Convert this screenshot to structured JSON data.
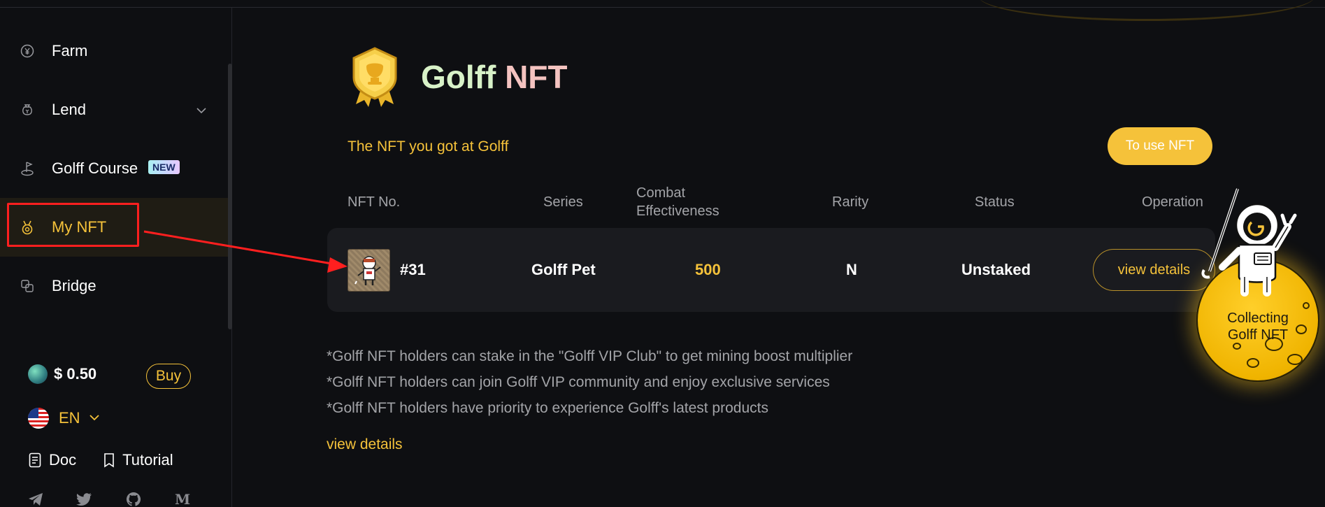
{
  "sidebar": {
    "items": [
      {
        "label": "Farm",
        "icon": "yen-coin-icon"
      },
      {
        "label": "Lend",
        "icon": "money-bag-icon"
      },
      {
        "label": "Golff Course",
        "icon": "golf-flag-icon",
        "badge": "NEW"
      },
      {
        "label": "My NFT",
        "icon": "medal-icon",
        "active": true
      },
      {
        "label": "Bridge",
        "icon": "bridge-icon"
      }
    ],
    "price": "$ 0.50",
    "buy_label": "Buy",
    "language": "EN",
    "links": [
      {
        "label": "Doc",
        "icon": "document-icon"
      },
      {
        "label": "Tutorial",
        "icon": "bookmark-icon"
      }
    ],
    "social": [
      "telegram-icon",
      "twitter-icon",
      "github-icon",
      "medium-icon"
    ]
  },
  "main": {
    "title_part1": "Golff",
    "title_part2": "NFT",
    "subtitle": "The NFT you got at Golff",
    "use_button": "To use NFT",
    "table": {
      "headers": {
        "nft_no": "NFT No.",
        "series": "Series",
        "combat_line1": "Combat",
        "combat_line2": "Effectiveness",
        "rarity": "Rarity",
        "status": "Status",
        "operation": "Operation"
      },
      "rows": [
        {
          "nft_no": "#31",
          "series": "Golff Pet",
          "combat": "500",
          "rarity": "N",
          "status": "Unstaked",
          "operation": "view details"
        }
      ]
    },
    "notes": [
      "*Golff NFT holders can stake in the \"Golff VIP Club\" to get mining boost multiplier",
      "*Golff NFT holders can join Golff VIP community and enjoy exclusive services",
      "*Golff NFT holders have priority to experience Golff's latest products"
    ],
    "view_details_link": "view details",
    "floating_badge_line1": "Collecting",
    "floating_badge_line2": "Golff NFT"
  },
  "colors": {
    "accent": "#f5c23a",
    "background": "#0e0f12",
    "row_bg": "#1a1b1f",
    "annotation": "#ff1f1f"
  }
}
